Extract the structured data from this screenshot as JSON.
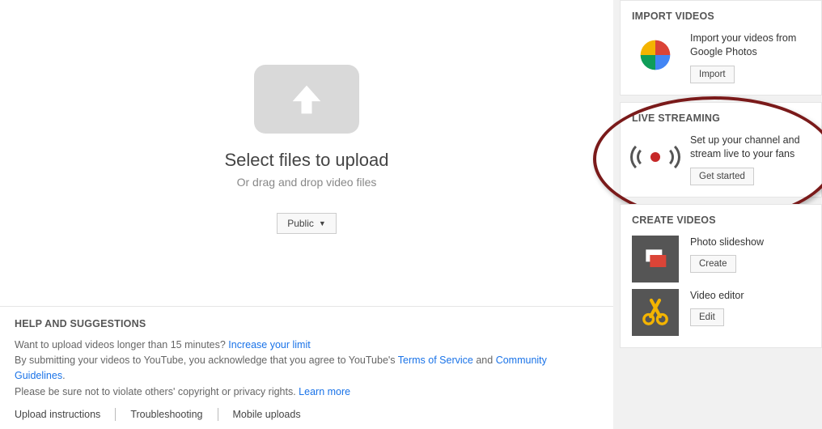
{
  "upload": {
    "title": "Select files to upload",
    "subtitle": "Or drag and drop video files",
    "privacy_label": "Public"
  },
  "help": {
    "title": "HELP AND SUGGESTIONS",
    "line1_a": "Want to upload videos longer than 15 minutes? ",
    "line1_link": "Increase your limit",
    "line2_a": "By submitting your videos to YouTube, you acknowledge that you agree to YouTube's ",
    "tos": "Terms of Service",
    "and": " and ",
    "cg": "Community Guidelines",
    "line3_a": "Please be sure not to violate others' copyright or privacy rights. ",
    "learn_more": "Learn more",
    "link_instructions": "Upload instructions",
    "link_troubleshooting": "Troubleshooting",
    "link_mobile": "Mobile uploads"
  },
  "sidebar": {
    "import": {
      "title": "IMPORT VIDEOS",
      "desc": "Import your videos from Google Photos",
      "button": "Import"
    },
    "live": {
      "title": "LIVE STREAMING",
      "desc": "Set up your channel and stream live to your fans",
      "button": "Get started"
    },
    "create": {
      "title": "CREATE VIDEOS",
      "slideshow_label": "Photo slideshow",
      "slideshow_button": "Create",
      "editor_label": "Video editor",
      "editor_button": "Edit"
    }
  }
}
